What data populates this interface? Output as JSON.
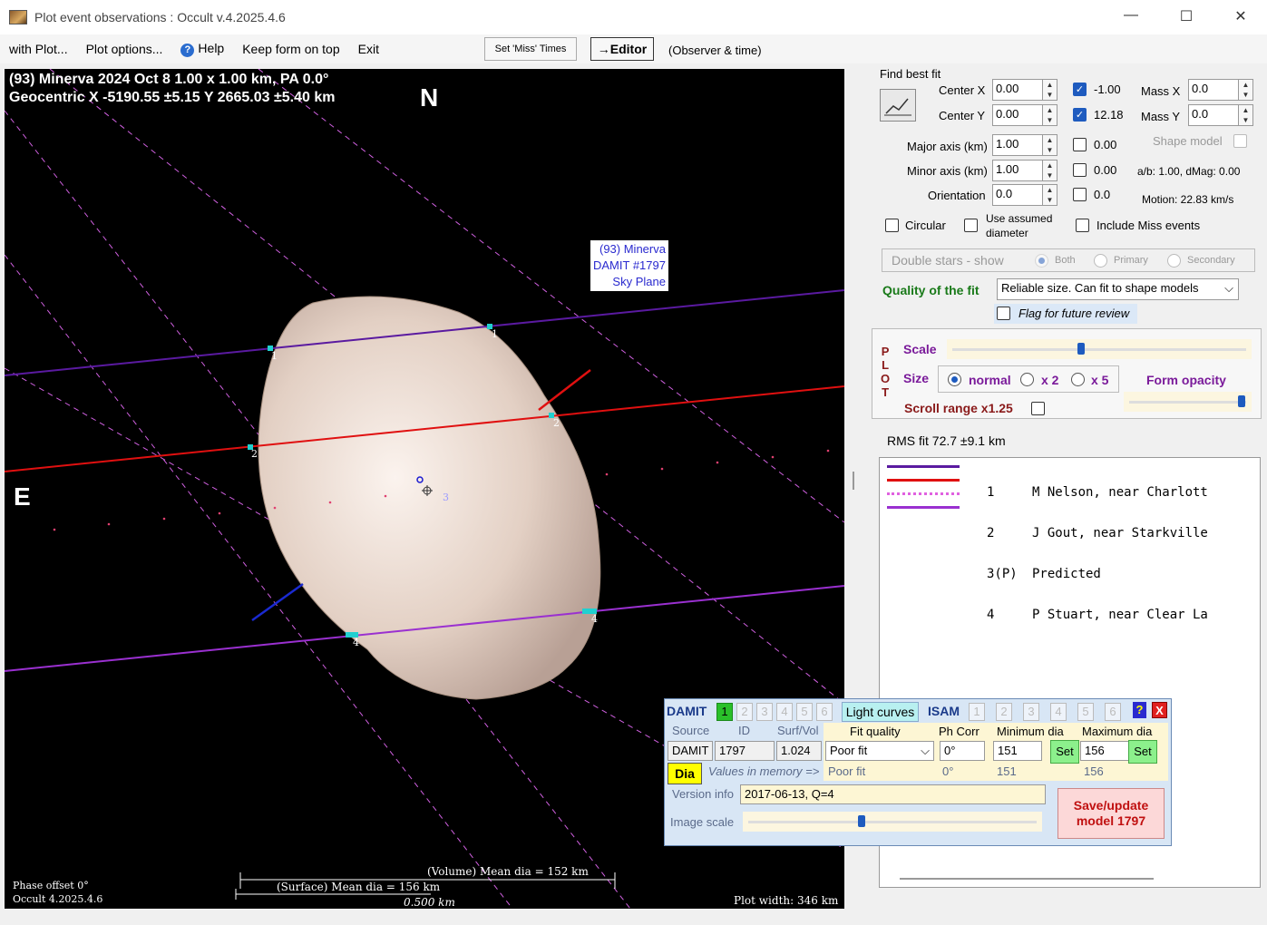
{
  "window": {
    "title": "Plot event observations : Occult v.4.2025.4.6",
    "minimize": "—",
    "maximize": "☐",
    "close": "✕"
  },
  "menu": {
    "with_plot": "with Plot...",
    "plot_options": "Plot options...",
    "help": "Help",
    "keep_on_top": "Keep form on top",
    "exit": "Exit",
    "set_miss_times": "Set 'Miss' Times",
    "editor": "→Editor",
    "observer_time": "(Observer & time)"
  },
  "plot": {
    "title1": "(93) Minerva  2024 Oct 8   1.00 x 1.00 km, PA 0.0°",
    "title2": "Geocentric  X  -5190.55 ±5.15  Y 2665.03 ±5.40 km",
    "north": "N",
    "east": "E",
    "label_lines": [
      "(93) Minerva",
      "DAMIT #1797",
      "Sky Plane"
    ],
    "chord_labels": [
      "1",
      "2",
      "4",
      "1",
      "2",
      "4",
      "3"
    ],
    "volume_dia": "(Volume) Mean dia = 152 km",
    "surface_dia": "(Surface) Mean dia = 156 km",
    "scale_bar": "0.500 km",
    "phase_offset": "Phase offset 0°",
    "version": "Occult 4.2025.4.6",
    "plot_width": "Plot width: 346 km"
  },
  "fit": {
    "find_best_fit": "Find best fit",
    "center_x_label": "Center X",
    "center_x": "0.00",
    "center_y_label": "Center Y",
    "center_y": "0.00",
    "cx_uncert": "-1.00",
    "cy_uncert": "12.18",
    "mass_x_label": "Mass X",
    "mass_x": "0.0",
    "mass_y_label": "Mass Y",
    "mass_y": "0.0",
    "major_label": "Major axis (km)",
    "major": "1.00",
    "major_unc": "0.00",
    "minor_label": "Minor axis (km)",
    "minor": "1.00",
    "minor_unc": "0.00",
    "orient_label": "Orientation",
    "orient": "0.0",
    "orient_unc": "0.0",
    "shape_model": "Shape model",
    "ab_dmag": "a/b: 1.00, dMag: 0.00",
    "motion": "Motion: 22.83 km/s",
    "circular": "Circular",
    "use_assumed": "Use assumed",
    "diameter": "diameter",
    "include_miss": "Include Miss events",
    "double_stars": "Double stars - show",
    "both": "Both",
    "primary": "Primary",
    "secondary": "Secondary",
    "quality_label": "Quality of the fit",
    "quality_value": "Reliable size. Can fit to shape models",
    "flag_review": "Flag for future review"
  },
  "plotbox": {
    "plot_letters": [
      "P",
      "L",
      "O",
      "T"
    ],
    "scale": "Scale",
    "size": "Size",
    "normal": "normal",
    "x2": "x 2",
    "x5": "x 5",
    "form_opacity": "Form opacity",
    "scroll_range": "Scroll range x1.25"
  },
  "rms": "RMS fit 72.7 ±9.1 km",
  "legend": [
    {
      "num": "1",
      "name": "M Nelson, near Charlott",
      "color": "#5a1aa0"
    },
    {
      "num": "2",
      "name": "J Gout, near Starkville",
      "color": "#e01010"
    },
    {
      "num": "3(P)",
      "name": "Predicted",
      "color": "#e060e0"
    },
    {
      "num": "4",
      "name": "P Stuart, near Clear La",
      "color": "#9a30d0"
    }
  ],
  "damit": {
    "damit": "DAMIT",
    "nums": [
      "1",
      "2",
      "3",
      "4",
      "5",
      "6"
    ],
    "light_curves": "Light curves",
    "isam": "ISAM",
    "isam_nums": [
      "1",
      "2",
      "3",
      "4",
      "5",
      "6"
    ],
    "help": "?",
    "close": "X",
    "source_h": "Source",
    "id_h": "ID",
    "surf_h": "Surf/Vol",
    "fitq_h": "Fit quality",
    "phcorr_h": "Ph Corr",
    "min_h": "Minimum dia",
    "max_h": "Maximum dia",
    "source": "DAMIT",
    "id": "1797",
    "surf": "1.024",
    "fitq": "Poor fit",
    "phcorr": "0°",
    "min": "151",
    "max": "156",
    "set": "Set",
    "dia": "Dia",
    "memory": "Values in memory =>",
    "mem_fitq": "Poor fit",
    "mem_ph": "0°",
    "mem_min": "151",
    "mem_max": "156",
    "version_label": "Version info",
    "version": "2017-06-13, Q=4",
    "image_scale": "Image scale",
    "save": "Save/update",
    "model": "model  1797"
  }
}
